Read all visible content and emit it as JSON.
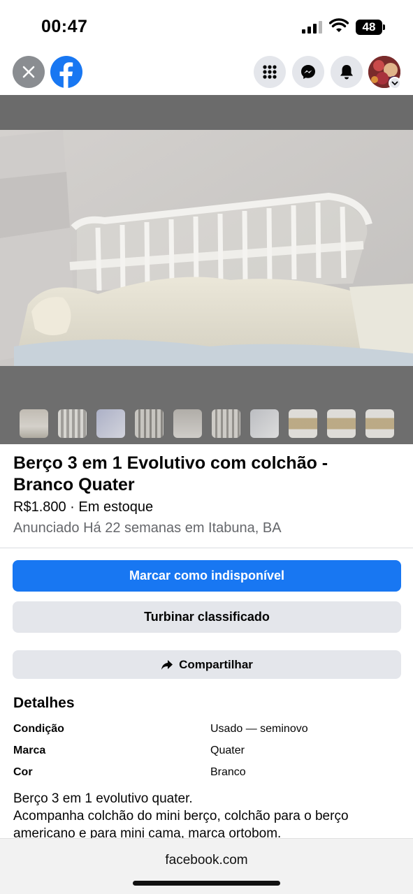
{
  "status_bar": {
    "time": "00:47",
    "battery": "48"
  },
  "header": {
    "close_icon": "close-icon",
    "logo_icon": "facebook-logo-icon",
    "menu_icon": "grid-menu-icon",
    "messenger_icon": "messenger-icon",
    "notifications_icon": "bell-icon",
    "profile_icon": "avatar"
  },
  "listing": {
    "title": "Berço 3 em 1 Evolutivo com colchão - Branco Quater",
    "price_stock": "R$1.800 · Em estoque",
    "listed": "Anunciado Há 22 semanas em Itabuna, BA",
    "thumbnail_count": 10
  },
  "actions": {
    "primary": "Marcar como indisponível",
    "boost": "Turbinar classificado",
    "share": "Compartilhar"
  },
  "details": {
    "heading": "Detalhes",
    "rows": [
      {
        "label": "Condição",
        "value": "Usado — seminovo"
      },
      {
        "label": "Marca",
        "value": "Quater"
      },
      {
        "label": "Cor",
        "value": "Branco"
      }
    ]
  },
  "description": {
    "line1": "Berço 3 em 1 evolutivo quater.",
    "line2": "Acompanha colchão do mini berço, colchão para o berço americano e para mini cama, marca ortobom."
  },
  "browser": {
    "url": "facebook.com"
  },
  "colors": {
    "primary": "#1877f2",
    "secondary_bg": "#e4e6eb",
    "muted_text": "#65676b"
  }
}
